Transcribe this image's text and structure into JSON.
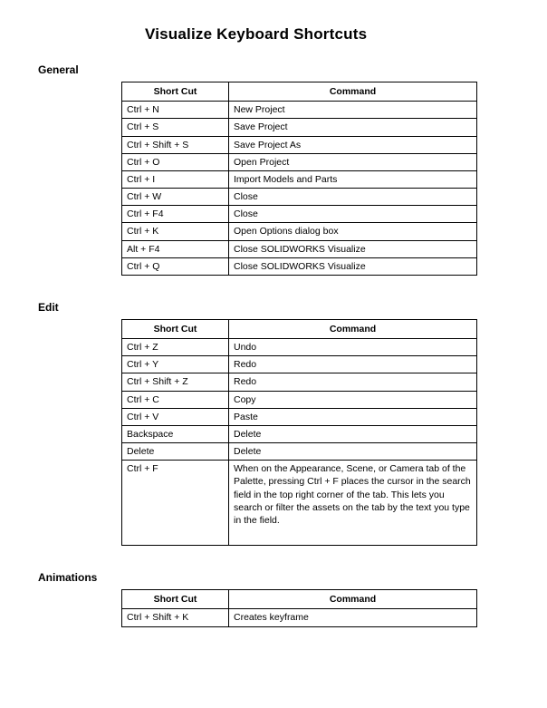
{
  "title": "Visualize Keyboard Shortcuts",
  "sections": [
    {
      "heading": "General",
      "headers": {
        "shortcut": "Short Cut",
        "command": "Command"
      },
      "rows": [
        {
          "shortcut": "Ctrl + N",
          "command": "New Project"
        },
        {
          "shortcut": "Ctrl + S",
          "command": "Save Project"
        },
        {
          "shortcut": "Ctrl + Shift + S",
          "command": "Save Project As"
        },
        {
          "shortcut": "Ctrl + O",
          "command": "Open Project"
        },
        {
          "shortcut": "Ctrl + I",
          "command": "Import Models and Parts"
        },
        {
          "shortcut": "Ctrl + W",
          "command": "Close"
        },
        {
          "shortcut": "Ctrl + F4",
          "command": "Close"
        },
        {
          "shortcut": "Ctrl + K",
          "command": "Open Options dialog box"
        },
        {
          "shortcut": "Alt + F4",
          "command": "Close SOLIDWORKS Visualize"
        },
        {
          "shortcut": "Ctrl + Q",
          "command": "Close SOLIDWORKS Visualize"
        }
      ]
    },
    {
      "heading": "Edit",
      "headers": {
        "shortcut": "Short Cut",
        "command": "Command"
      },
      "rows": [
        {
          "shortcut": "Ctrl + Z",
          "command": "Undo"
        },
        {
          "shortcut": "Ctrl + Y",
          "command": "Redo"
        },
        {
          "shortcut": "Ctrl + Shift + Z",
          "command": "Redo"
        },
        {
          "shortcut": "Ctrl + C",
          "command": "Copy"
        },
        {
          "shortcut": "Ctrl + V",
          "command": "Paste"
        },
        {
          "shortcut": "Backspace",
          "command": "Delete"
        },
        {
          "shortcut": "Delete",
          "command": "Delete"
        },
        {
          "shortcut": "Ctrl + F",
          "command": "When on the Appearance, Scene, or Camera tab of the Palette, pressing Ctrl + F places the cursor in the search field in the top right corner of the tab. This lets you search or filter the assets on the tab by the text you type in the field.",
          "tall": true
        }
      ]
    },
    {
      "heading": "Animations",
      "headers": {
        "shortcut": "Short Cut",
        "command": "Command"
      },
      "rows": [
        {
          "shortcut": "Ctrl + Shift + K",
          "command": "Creates keyframe"
        }
      ]
    }
  ]
}
